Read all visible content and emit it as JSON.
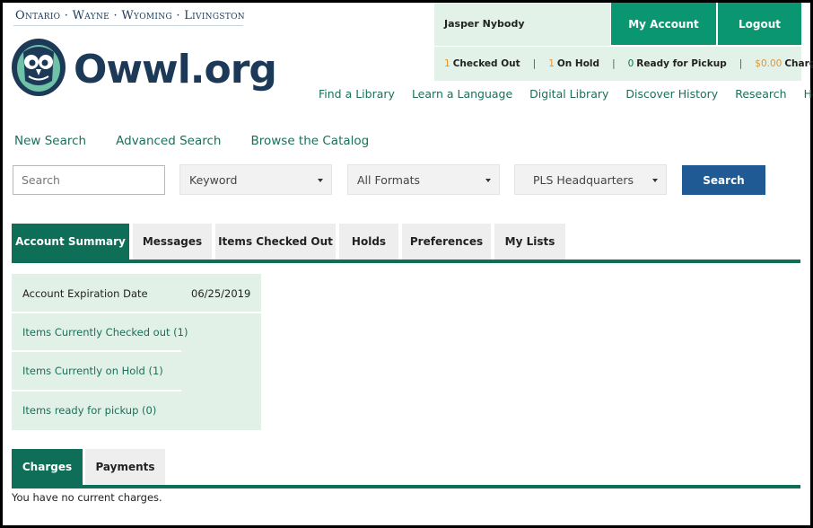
{
  "brand": {
    "counties": "Ontario · Wayne · Wyoming · Livingston",
    "logo_text": "Owwl.org"
  },
  "account": {
    "user_name": "Jasper Nybody",
    "my_account_label": "My Account",
    "logout_label": "Logout"
  },
  "status": {
    "checked_out_count": "1",
    "checked_out_label": "Checked Out",
    "on_hold_count": "1",
    "on_hold_label": "On Hold",
    "ready_count": "0",
    "ready_label": "Ready for Pickup",
    "charges_amount": "$0.00",
    "charges_label": "Charges",
    "separator": "|"
  },
  "topnav": [
    "Find a Library",
    "Learn a Language",
    "Digital Library",
    "Discover History",
    "Research",
    "Help"
  ],
  "search_links": [
    "New Search",
    "Advanced Search",
    "Browse the Catalog"
  ],
  "search": {
    "placeholder": "Search",
    "type_selected": "Keyword",
    "format_selected": "All Formats",
    "location_selected": "PLS Headquarters",
    "button_label": "Search"
  },
  "tabs": [
    {
      "label": "Account Summary",
      "active": true
    },
    {
      "label": "Messages",
      "active": false
    },
    {
      "label": "Items Checked Out",
      "active": false
    },
    {
      "label": "Holds",
      "active": false
    },
    {
      "label": "Preferences",
      "active": false
    },
    {
      "label": "My Lists",
      "active": false
    }
  ],
  "summary": {
    "expiration_label": "Account Expiration Date",
    "expiration_value": "06/25/2019",
    "checked_out_link": "Items Currently Checked out (1)",
    "on_hold_link": "Items Currently on Hold (1)",
    "ready_link": "Items ready for pickup (0)"
  },
  "charges_tabs": [
    {
      "label": "Charges",
      "active": true
    },
    {
      "label": "Payments",
      "active": false
    }
  ],
  "charges_message": "You have no current charges.",
  "colors": {
    "primary_green": "#0a9671",
    "dark_green": "#0e6e58",
    "light_green": "#e3f2e9",
    "navy": "#1c3a57",
    "search_blue": "#1f5a94",
    "count_orange": "#e6942e"
  }
}
